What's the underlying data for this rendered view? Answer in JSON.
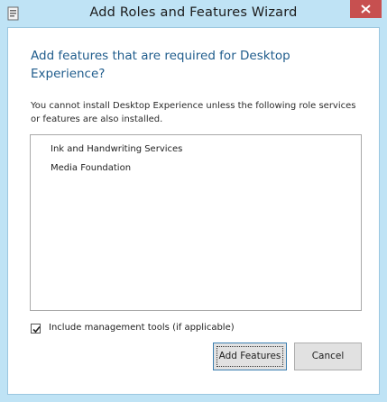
{
  "window": {
    "title": "Add Roles and Features Wizard",
    "icon": "server-manager-icon",
    "close_icon": "close-icon"
  },
  "dialog": {
    "heading": "Add features that are required for Desktop Experience?",
    "description": "You cannot install Desktop Experience unless the following role services or features are also installed.",
    "features": [
      "Ink and Handwriting Services",
      "Media Foundation"
    ],
    "include_tools": {
      "label": "Include management tools (if applicable)",
      "checked": true
    },
    "buttons": {
      "add": "Add Features",
      "cancel": "Cancel"
    }
  },
  "colors": {
    "frame": "#bfe3f5",
    "heading": "#1f5c8c",
    "close": "#c75050"
  }
}
